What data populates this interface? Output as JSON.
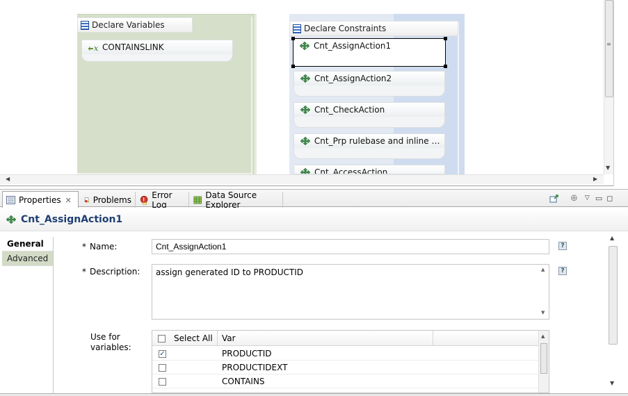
{
  "diagram": {
    "declare_variables": {
      "title": "Declare Variables",
      "items": [
        "CONTAINSLINK"
      ]
    },
    "declare_constraints": {
      "title": "Declare Constraints",
      "items": [
        "Cnt_AssignAction1",
        "Cnt_AssignAction2",
        "Cnt_CheckAction",
        "Cnt_Prp rulebase and inline Act...",
        "Cnt_AccessAction"
      ]
    }
  },
  "view_tabs": [
    {
      "label": "Properties",
      "icon": "properties-icon"
    },
    {
      "label": "Problems",
      "icon": "problems-icon"
    },
    {
      "label": "Error Log",
      "icon": "error-log-icon"
    },
    {
      "label": "Data Source Explorer",
      "icon": "data-source-explorer-icon"
    }
  ],
  "properties": {
    "title": "Cnt_AssignAction1",
    "side_tabs": [
      "General",
      "Advanced"
    ],
    "name_label": "Name:",
    "name_value": "Cnt_AssignAction1",
    "description_label": "Description:",
    "description_value": "assign generated ID to PRODUCTID",
    "use_for_label_1": "Use for",
    "use_for_label_2": "variables:",
    "required_mark": "*",
    "help_glyph": "?",
    "table": {
      "select_all": "Select All",
      "var_header": "Var",
      "rows": [
        {
          "var": "PRODUCTID",
          "checked": true
        },
        {
          "var": "PRODUCTIDEXT",
          "checked": false
        },
        {
          "var": "CONTAINS",
          "checked": false
        }
      ]
    }
  },
  "colors": {
    "variables_block": "#d5dfc9",
    "constraints_block": "#e2e9f3",
    "title_text": "#1f3f73",
    "advanced_tab": "#d3dbc7"
  }
}
